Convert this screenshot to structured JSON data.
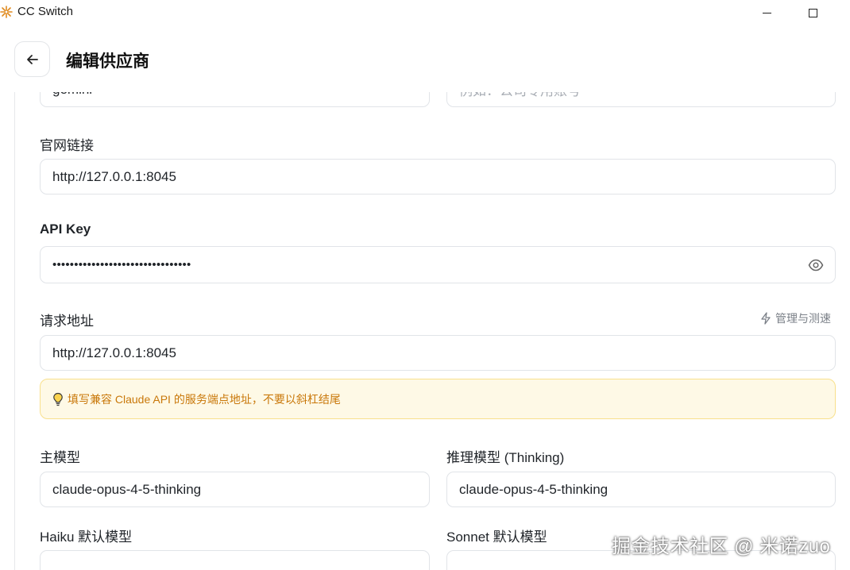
{
  "window": {
    "title": "CC Switch"
  },
  "header": {
    "title": "编辑供应商"
  },
  "form": {
    "name_value": "gemini",
    "note_placeholder": "例如：公司专用账号",
    "website_label": "官网链接",
    "website_value": "http://127.0.0.1:8045",
    "apikey_label": "API Key",
    "apikey_value": "••••••••••••••••••••••••••••••••",
    "endpoint_label": "请求地址",
    "endpoint_manage_label": "管理与测速",
    "endpoint_value": "http://127.0.0.1:8045",
    "endpoint_hint": "填写兼容 Claude API 的服务端点地址，不要以斜杠结尾",
    "main_model_label": "主模型",
    "main_model_value": "claude-opus-4-5-thinking",
    "thinking_model_label": "推理模型 (Thinking)",
    "thinking_model_value": "claude-opus-4-5-thinking",
    "haiku_label": "Haiku 默认模型",
    "sonnet_label": "Sonnet 默认模型"
  },
  "watermark": "掘金技术社区 @ 米诺zuo",
  "colors": {
    "hint_bg": "#fef9e6",
    "hint_border": "#f8e08c",
    "hint_text": "#c9780a",
    "border": "#e1e4e8"
  },
  "icons": {
    "back": "arrow-left-icon",
    "eye": "eye-icon",
    "lightning": "lightning-icon",
    "bulb": "lightbulb-icon"
  }
}
